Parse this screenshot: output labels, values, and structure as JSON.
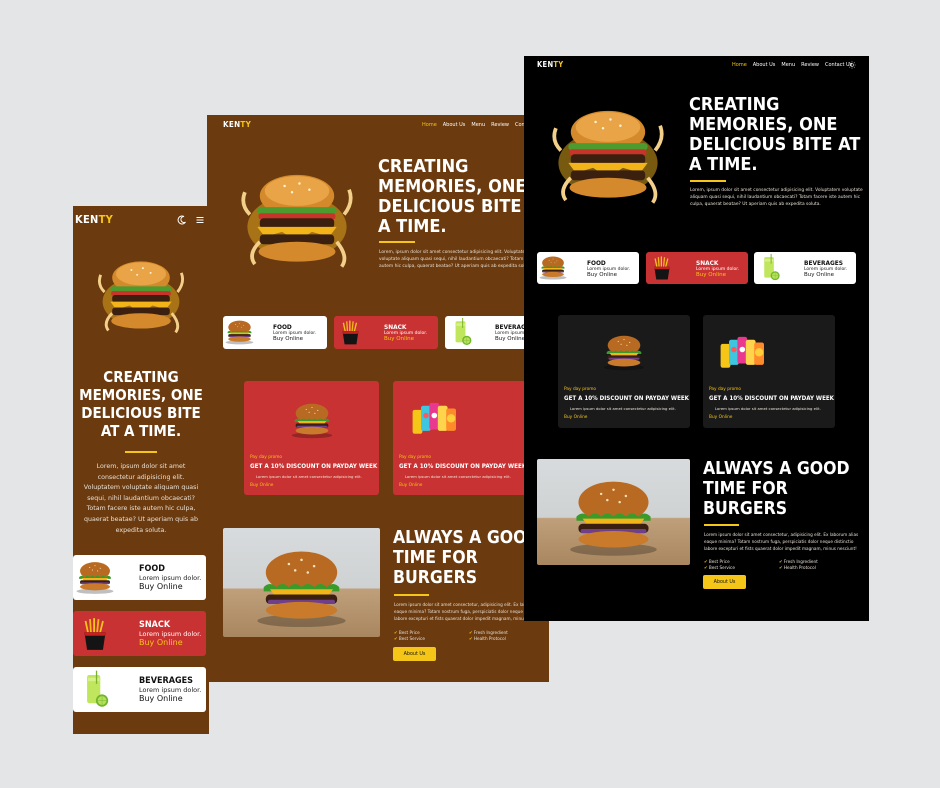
{
  "brand": {
    "ken": "KEN",
    "ty": "TY"
  },
  "nav": [
    "Home",
    "About Us",
    "Menu",
    "Review",
    "Contact Us"
  ],
  "nav_tablet": [
    "Home",
    "About Us",
    "Menu",
    "Review",
    "Contact"
  ],
  "hero": {
    "title": "CREATING MEMORIES, ONE DELICIOUS BITE AT A TIME.",
    "text": "Lorem, ipsum dolor sit amet consectetur adipisicing elit. Voluptatem voluptate aliquam quasi sequi, nihil laudantium obcaecati? Totam facere iste autem hic culpa, quaerat beatae? Ut aperiam quis ab expedita soluta."
  },
  "categories": [
    {
      "title": "FOOD",
      "lorem": "Lorem ipsum dolor.",
      "buy": "Buy Online"
    },
    {
      "title": "SNACK",
      "lorem": "Lorem ipsum dolor.",
      "buy": "Buy Online"
    },
    {
      "title": "BEVERAGES",
      "lorem": "Lorem ipsum dolor.",
      "buy": "Buy Online"
    }
  ],
  "promo": {
    "label": "Pay day promo",
    "title": "GET A 10% DISCOUNT ON PAYDAY WEEK",
    "text": "Lorem ipsum dolor sit amet consectetur adipisicing elit.",
    "link": "Buy Online"
  },
  "about": {
    "title": "ALWAYS A GOOD TIME FOR BURGERS",
    "text": "Lorem ipsum dolor sit amet consectetur, adipisicing elit. Ex laborum alias eaque minima? Totam nostrum fuga, perspiciatis dolor neque distinctio labore excepturi et fists quaerat dolor impedit magnam, minus nesciunt!",
    "features": [
      "Best Price",
      "Fresh Ingredient",
      "Best Service",
      "Health Protocol"
    ],
    "button": "About Us"
  },
  "colors": {
    "brown": "#6b3a0e",
    "red": "#c93232",
    "yellow": "#f5c518",
    "black": "#000000",
    "card_dark": "#1a1a1a"
  },
  "icons": {
    "theme_toggle": "moon-icon",
    "menu": "hamburger-icon",
    "theme_light": "sun-icon"
  }
}
